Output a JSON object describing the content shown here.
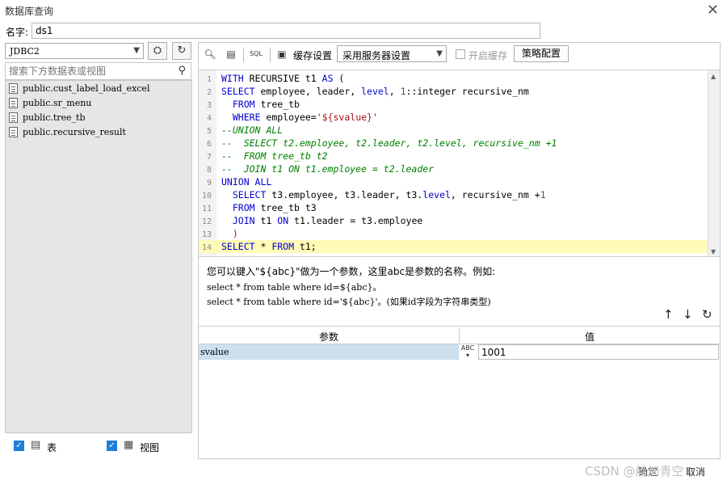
{
  "window": {
    "title": "数据库查询",
    "close_icon": "close-icon"
  },
  "name_row": {
    "label": "名字:",
    "value": "ds1"
  },
  "left": {
    "db_select": "JDBC2",
    "search_placeholder": "搜索下方数据表或视图",
    "tables": [
      "public.cust_label_load_excel",
      "public.sr_menu",
      "public.tree_tb",
      "public.recursive_result"
    ],
    "show_tables_label": "表",
    "show_views_label": "视图"
  },
  "toolbar": {
    "cache_label": "缓存设置",
    "cache_option": "采用服务器设置",
    "enable_cache_label": "开启缓存",
    "policy_button": "策略配置"
  },
  "editor": {
    "lines": [
      "1",
      "2",
      "3",
      "4",
      "5",
      "6",
      "7",
      "8",
      "9",
      "10",
      "11",
      "12",
      "13",
      "14"
    ],
    "highlight_line": 14
  },
  "hint": {
    "line1": "您可以键入\"${abc}\"做为一个参数，这里abc是参数的名称。例如:",
    "line2": "select * from table where id=${abc}。",
    "line3": "select * from table where id='${abc}'。(如果id字段为字符串类型)"
  },
  "params": {
    "header_name": "参数",
    "header_value": "值",
    "rows": [
      {
        "name": "svalue",
        "value": "1001"
      }
    ]
  },
  "footer": {
    "ok": "确定",
    "cancel": "取消",
    "watermark": "CSDN @赫加青空"
  }
}
